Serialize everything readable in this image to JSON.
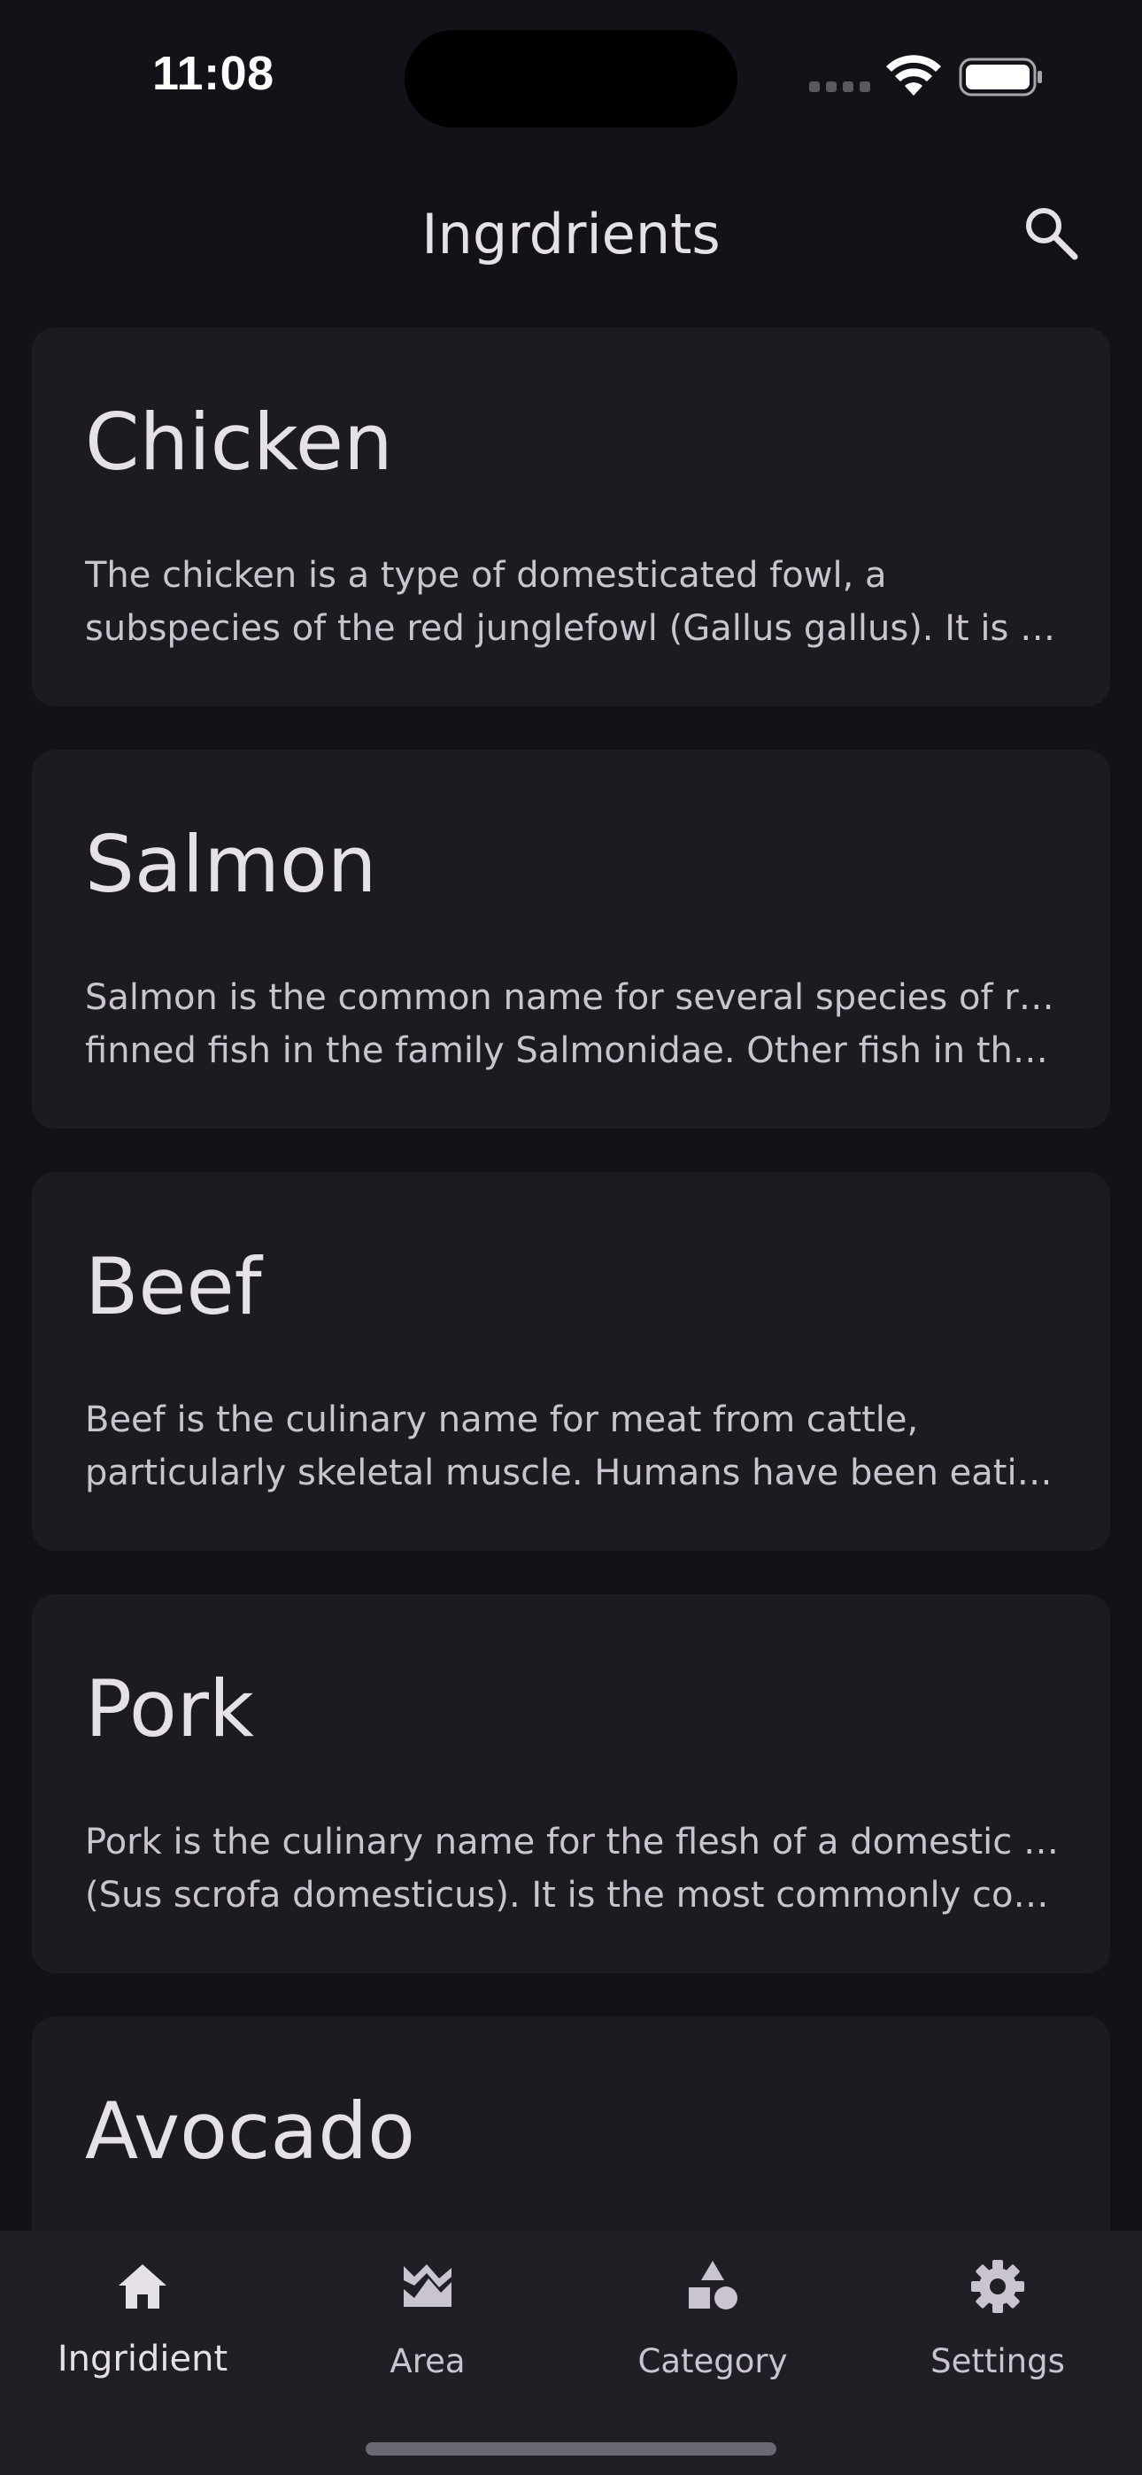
{
  "status_bar": {
    "time": "11:08"
  },
  "app_bar": {
    "title": "Ingrdrients",
    "search_icon": "search-icon"
  },
  "ingredients": [
    {
      "name": "Chicken",
      "desc_line1": "The chicken is a type of domesticated fowl, a",
      "desc_line2": "subspecies of the red junglefowl (Gallus gallus). It is o..."
    },
    {
      "name": "Salmon",
      "desc_line1": "Salmon is the common name for several species of ray-",
      "desc_line2": "finned fish in the family Salmonidae. Other fish in the ..."
    },
    {
      "name": "Beef",
      "desc_line1": "Beef is the culinary name for meat from cattle,",
      "desc_line2": "particularly skeletal muscle. Humans have been eatin..."
    },
    {
      "name": "Pork",
      "desc_line1": "Pork is the culinary name for the flesh of a domestic pig",
      "desc_line2": "(Sus scrofa domesticus). It is the most commonly con..."
    },
    {
      "name": "Avocado"
    }
  ],
  "bottom_nav": {
    "items": [
      {
        "label": "Ingridient",
        "icon": "home-icon",
        "active": true
      },
      {
        "label": "Area",
        "icon": "landscape-icon",
        "active": false
      },
      {
        "label": "Category",
        "icon": "category-icon",
        "active": false
      },
      {
        "label": "Settings",
        "icon": "gear-icon",
        "active": false
      }
    ]
  },
  "colors": {
    "background": "#141218",
    "card": "#1d1b20",
    "nav_background": "#211f26",
    "text_primary": "#e6e0e9",
    "text_secondary": "#cac4d0"
  }
}
